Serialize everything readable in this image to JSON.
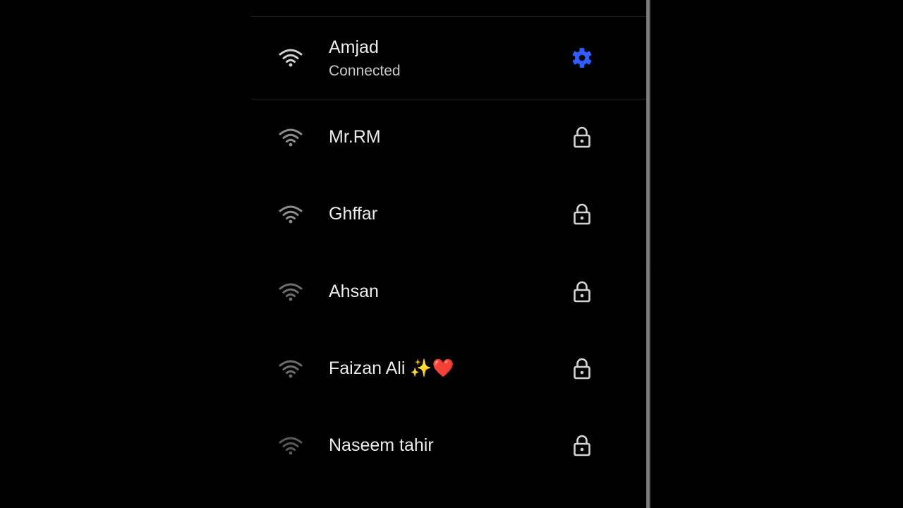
{
  "colors": {
    "background": "#000000",
    "accent": "#2f5dff",
    "text_primary": "#ececec",
    "icon_muted": "#bdbdbd"
  },
  "networks": [
    {
      "name": "Amjad",
      "status": "Connected",
      "action_icon": "gear-icon"
    },
    {
      "name": "Mr.RM",
      "action_icon": "lock-icon"
    },
    {
      "name": "Ghffar",
      "action_icon": "lock-icon"
    },
    {
      "name": "Ahsan",
      "action_icon": "lock-icon"
    },
    {
      "name": "Faizan Ali ✨❤️",
      "action_icon": "lock-icon"
    },
    {
      "name": "Naseem tahir",
      "action_icon": "lock-icon"
    }
  ]
}
